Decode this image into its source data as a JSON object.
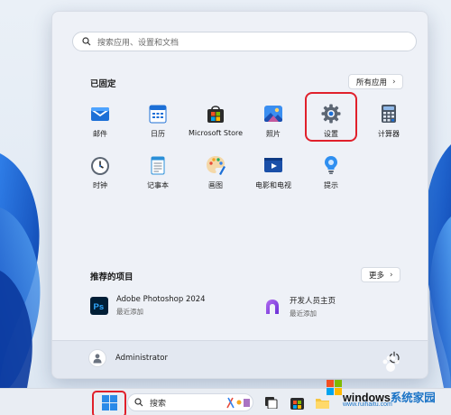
{
  "start_menu": {
    "search": {
      "placeholder": "搜索应用、设置和文档"
    },
    "pinned": {
      "title": "已固定",
      "all_apps_label": "所有应用",
      "apps": [
        {
          "id": "mail",
          "label": "邮件",
          "icon": "mail-icon"
        },
        {
          "id": "calendar",
          "label": "日历",
          "icon": "calendar-icon"
        },
        {
          "id": "store",
          "label": "Microsoft Store",
          "icon": "store-icon"
        },
        {
          "id": "photos",
          "label": "照片",
          "icon": "photos-icon"
        },
        {
          "id": "settings",
          "label": "设置",
          "icon": "gear-icon",
          "highlighted": true
        },
        {
          "id": "calculator",
          "label": "计算器",
          "icon": "calculator-icon"
        },
        {
          "id": "clock",
          "label": "时钟",
          "icon": "clock-icon"
        },
        {
          "id": "notepad",
          "label": "记事本",
          "icon": "notepad-icon"
        },
        {
          "id": "paint",
          "label": "画图",
          "icon": "paint-icon"
        },
        {
          "id": "movies",
          "label": "电影和电视",
          "icon": "movies-icon"
        },
        {
          "id": "tips",
          "label": "提示",
          "icon": "tips-icon"
        }
      ]
    },
    "recommended": {
      "title": "推荐的项目",
      "more_label": "更多",
      "items": [
        {
          "name": "Adobe Photoshop 2024",
          "sub": "最近添加",
          "icon": "photoshop-icon"
        },
        {
          "name": "开发人员主页",
          "sub": "最近添加",
          "icon": "dev-home-icon"
        }
      ]
    },
    "user": {
      "name": "Administrator"
    }
  },
  "taskbar": {
    "search_label": "搜索"
  },
  "watermark": {
    "title_main": "windows",
    "title_accent": "系统家园",
    "subtitle": "www.ruihaitu.com"
  },
  "colors": {
    "highlight": "#e0202b",
    "accent_blue": "#1a73c6",
    "menu_bg": "#eef1f7"
  }
}
